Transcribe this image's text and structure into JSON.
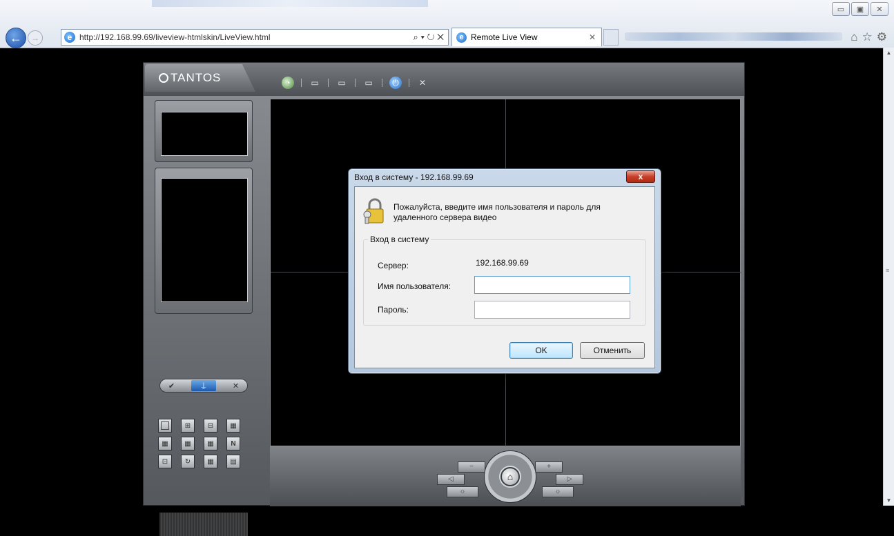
{
  "browser": {
    "address_url": "http://192.168.99.69/liveview-htmlskin/LiveView.html",
    "tab_title": "Remote Live View",
    "window_buttons": [
      "▭",
      "▣",
      "✕"
    ]
  },
  "app": {
    "logo_text": "TANTOS"
  },
  "dialog": {
    "title": "Вход в систему - 192.168.99.69",
    "message": "Пожалуйста, введите имя пользователя и пароль для удаленного сервера видео",
    "group_label": "Вход в систему",
    "server_label": "Сервер:",
    "server_value": "192.168.99.69",
    "username_label": "Имя пользователя:",
    "username_value": "",
    "password_label": "Пароль:",
    "password_value": "",
    "ok_label": "OK",
    "cancel_label": "Отменить",
    "close_glyph": "x"
  },
  "colors": {
    "dialog_frame": "#b3c7de",
    "close_red": "#c7402a",
    "app_gray": "#55595e"
  }
}
